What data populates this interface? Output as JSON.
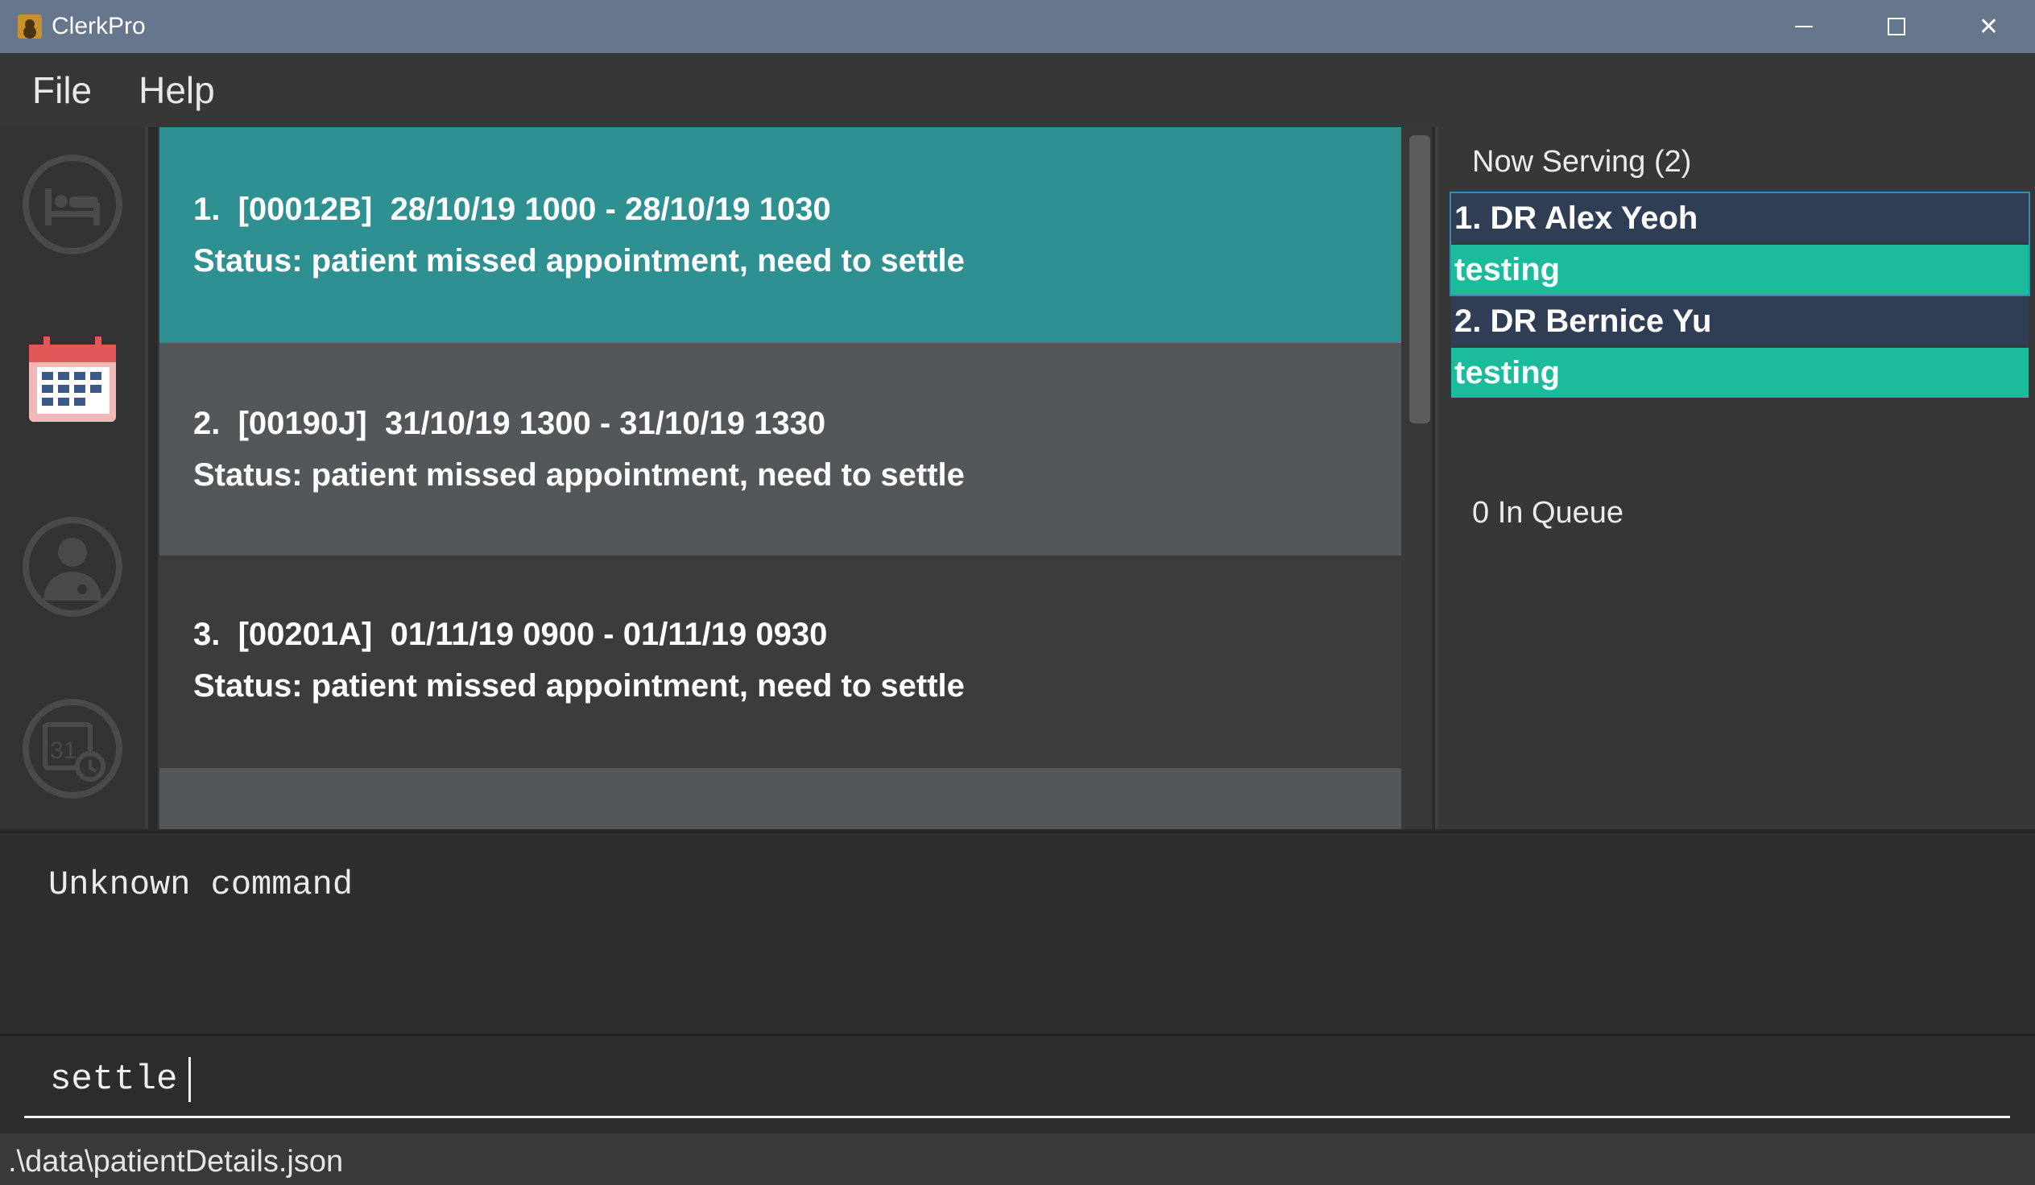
{
  "window": {
    "title": "ClerkPro",
    "min_glyph": "",
    "close_glyph": "✕"
  },
  "menu": {
    "file": "File",
    "help": "Help"
  },
  "sidebar": {
    "items": [
      {
        "icon": "bed-icon",
        "active": false
      },
      {
        "icon": "calendar-icon",
        "active": true
      },
      {
        "icon": "doctor-icon",
        "active": false
      },
      {
        "icon": "schedule-icon",
        "active": false
      }
    ]
  },
  "appointments": [
    {
      "index": "1.",
      "id": "[00012B]",
      "time": "28/10/19 1000 - 28/10/19 1030",
      "status": "Status: patient missed appointment, need to settle"
    },
    {
      "index": "2.",
      "id": "[00190J]",
      "time": "31/10/19 1300 - 31/10/19 1330",
      "status": "Status: patient missed appointment, need to settle"
    },
    {
      "index": "3.",
      "id": "[00201A]",
      "time": "01/11/19 0900 - 01/11/19 0930",
      "status": "Status: patient missed appointment, need to settle"
    }
  ],
  "queue": {
    "now_serving_heading": "Now Serving (2)",
    "doctors": [
      {
        "name": "1. DR Alex Yeoh",
        "status": "testing"
      },
      {
        "name": "2. DR Bernice Yu",
        "status": "testing"
      }
    ],
    "in_queue": "0 In Queue"
  },
  "result": {
    "message": "Unknown command"
  },
  "command": {
    "value": "settle"
  },
  "statusbar": {
    "path": ".\\data\\patientDetails.json"
  },
  "colors": {
    "selected_card": "#2e9090",
    "doctor_name_bg": "#2f3e54",
    "doctor_status_bg": "#1abc9c",
    "titlebar": "#66768c"
  }
}
